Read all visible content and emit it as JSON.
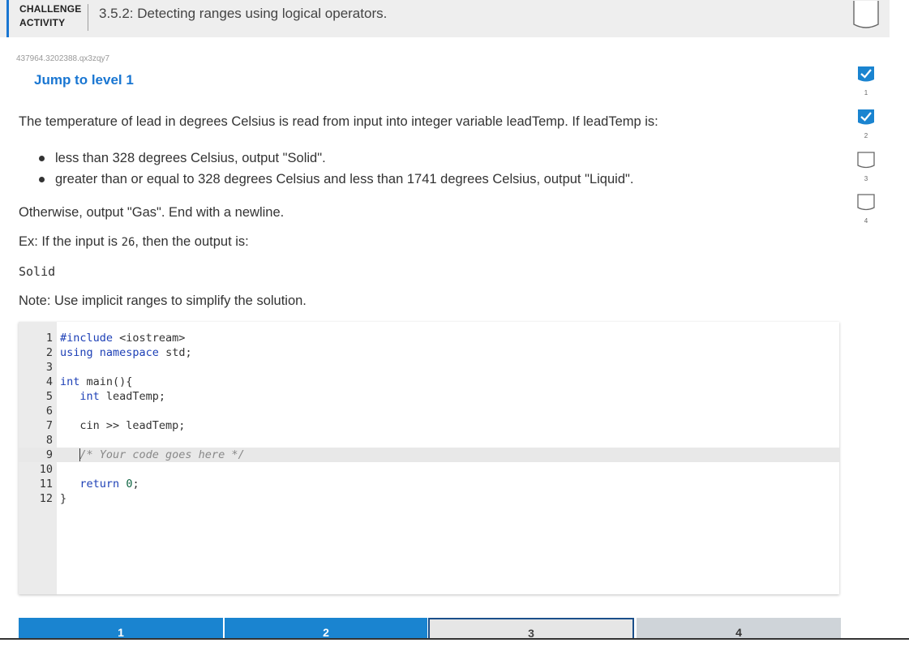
{
  "header": {
    "challenge_label_line1": "CHALLENGE",
    "challenge_label_line2": "ACTIVITY",
    "title": "3.5.2: Detecting ranges using logical operators."
  },
  "activity_id": "437964.3202388.qx3zqy7",
  "jump_link": "Jump to level 1",
  "prompt": "The temperature of lead in degrees Celsius is read from input into integer variable leadTemp. If leadTemp is:",
  "bullets": [
    "less than 328 degrees Celsius, output \"Solid\".",
    "greater than or equal to 328 degrees Celsius and less than 1741 degrees Celsius, output \"Liquid\"."
  ],
  "otherwise": "Otherwise, output \"Gas\". End with a newline.",
  "example": {
    "prefix": "Ex: If the input is ",
    "input": "26",
    "suffix": ", then the output is:"
  },
  "sample_output": "Solid",
  "note": "Note: Use implicit ranges to simplify the solution.",
  "code_lines": [
    {
      "num": "1",
      "text": "#include <iostream>"
    },
    {
      "num": "2",
      "text": "using namespace std;"
    },
    {
      "num": "3",
      "text": ""
    },
    {
      "num": "4",
      "text": "int main(){"
    },
    {
      "num": "5",
      "text": "   int leadTemp;"
    },
    {
      "num": "6",
      "text": ""
    },
    {
      "num": "7",
      "text": "   cin >> leadTemp;"
    },
    {
      "num": "8",
      "text": ""
    },
    {
      "num": "9",
      "text": "   /* Your code goes here */"
    },
    {
      "num": "10",
      "text": ""
    },
    {
      "num": "11",
      "text": "   return 0;"
    },
    {
      "num": "12",
      "text": "}"
    }
  ],
  "level_tabs": [
    "1",
    "2",
    "3",
    "4"
  ],
  "side_levels": [
    {
      "label": "1",
      "state": "complete"
    },
    {
      "label": "2",
      "state": "complete"
    },
    {
      "label": "3",
      "state": "incomplete"
    },
    {
      "label": "4",
      "state": "incomplete"
    }
  ],
  "colors": {
    "accent": "#1976d2",
    "tab_active": "#1a84d0",
    "complete": "#1a84d0"
  }
}
